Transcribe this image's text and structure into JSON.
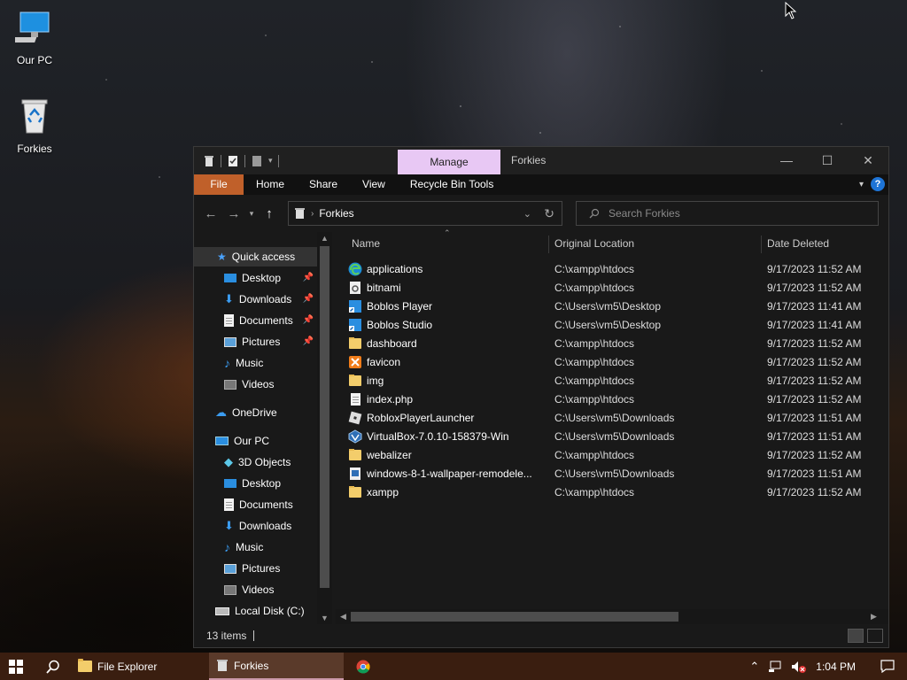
{
  "desktop": {
    "icons": [
      {
        "label": "Our PC"
      },
      {
        "label": "Forkies"
      }
    ]
  },
  "window": {
    "manage_tab": "Manage",
    "title": "Forkies",
    "controls": {
      "minimize": "—",
      "maximize": "☐",
      "close": "✕"
    },
    "ribbon_tabs": [
      "File",
      "Home",
      "Share",
      "View",
      "Recycle Bin Tools"
    ],
    "address": {
      "crumb": "Forkies"
    },
    "search": {
      "placeholder": "Search Forkies"
    },
    "nav": [
      {
        "label": "Quick access"
      },
      {
        "label": "Desktop"
      },
      {
        "label": "Downloads"
      },
      {
        "label": "Documents"
      },
      {
        "label": "Pictures"
      },
      {
        "label": "Music"
      },
      {
        "label": "Videos"
      },
      {
        "label": "OneDrive"
      },
      {
        "label": "Our PC"
      },
      {
        "label": "3D Objects"
      },
      {
        "label": "Desktop"
      },
      {
        "label": "Documents"
      },
      {
        "label": "Downloads"
      },
      {
        "label": "Music"
      },
      {
        "label": "Pictures"
      },
      {
        "label": "Videos"
      },
      {
        "label": "Local Disk (C:)"
      }
    ],
    "columns": {
      "name": "Name",
      "location": "Original Location",
      "date": "Date Deleted"
    },
    "files": [
      {
        "name": "applications",
        "location": "C:\\xampp\\htdocs",
        "date": "9/17/2023 11:52 AM",
        "icon": "edge-icon"
      },
      {
        "name": "bitnami",
        "location": "C:\\xampp\\htdocs",
        "date": "9/17/2023 11:52 AM",
        "icon": "settings-file-icon"
      },
      {
        "name": "Boblos Player",
        "location": "C:\\Users\\vm5\\Desktop",
        "date": "9/17/2023 11:41 AM",
        "icon": "shortcut-icon"
      },
      {
        "name": "Boblos Studio",
        "location": "C:\\Users\\vm5\\Desktop",
        "date": "9/17/2023 11:41 AM",
        "icon": "shortcut-icon"
      },
      {
        "name": "dashboard",
        "location": "C:\\xampp\\htdocs",
        "date": "9/17/2023 11:52 AM",
        "icon": "folder-icon"
      },
      {
        "name": "favicon",
        "location": "C:\\xampp\\htdocs",
        "date": "9/17/2023 11:52 AM",
        "icon": "xampp-icon"
      },
      {
        "name": "img",
        "location": "C:\\xampp\\htdocs",
        "date": "9/17/2023 11:52 AM",
        "icon": "folder-icon"
      },
      {
        "name": "index.php",
        "location": "C:\\xampp\\htdocs",
        "date": "9/17/2023 11:52 AM",
        "icon": "document-icon"
      },
      {
        "name": "RobloxPlayerLauncher",
        "location": "C:\\Users\\vm5\\Downloads",
        "date": "9/17/2023 11:51 AM",
        "icon": "roblox-icon"
      },
      {
        "name": "VirtualBox-7.0.10-158379-Win",
        "location": "C:\\Users\\vm5\\Downloads",
        "date": "9/17/2023 11:51 AM",
        "icon": "virtualbox-icon"
      },
      {
        "name": "webalizer",
        "location": "C:\\xampp\\htdocs",
        "date": "9/17/2023 11:52 AM",
        "icon": "folder-icon"
      },
      {
        "name": "windows-8-1-wallpaper-remodele...",
        "location": "C:\\Users\\vm5\\Downloads",
        "date": "9/17/2023 11:51 AM",
        "icon": "image-file-icon"
      },
      {
        "name": "xampp",
        "location": "C:\\xampp\\htdocs",
        "date": "9/17/2023 11:52 AM",
        "icon": "folder-icon"
      }
    ],
    "status": {
      "count": "13 items"
    }
  },
  "taskbar": {
    "items": [
      {
        "label": "File Explorer"
      },
      {
        "label": "Forkies"
      }
    ],
    "clock": "1:04 PM"
  },
  "colors": {
    "file_tab": "#c0602a",
    "manage_tab": "#e8c8f4",
    "taskbar": "#3a1e10"
  }
}
